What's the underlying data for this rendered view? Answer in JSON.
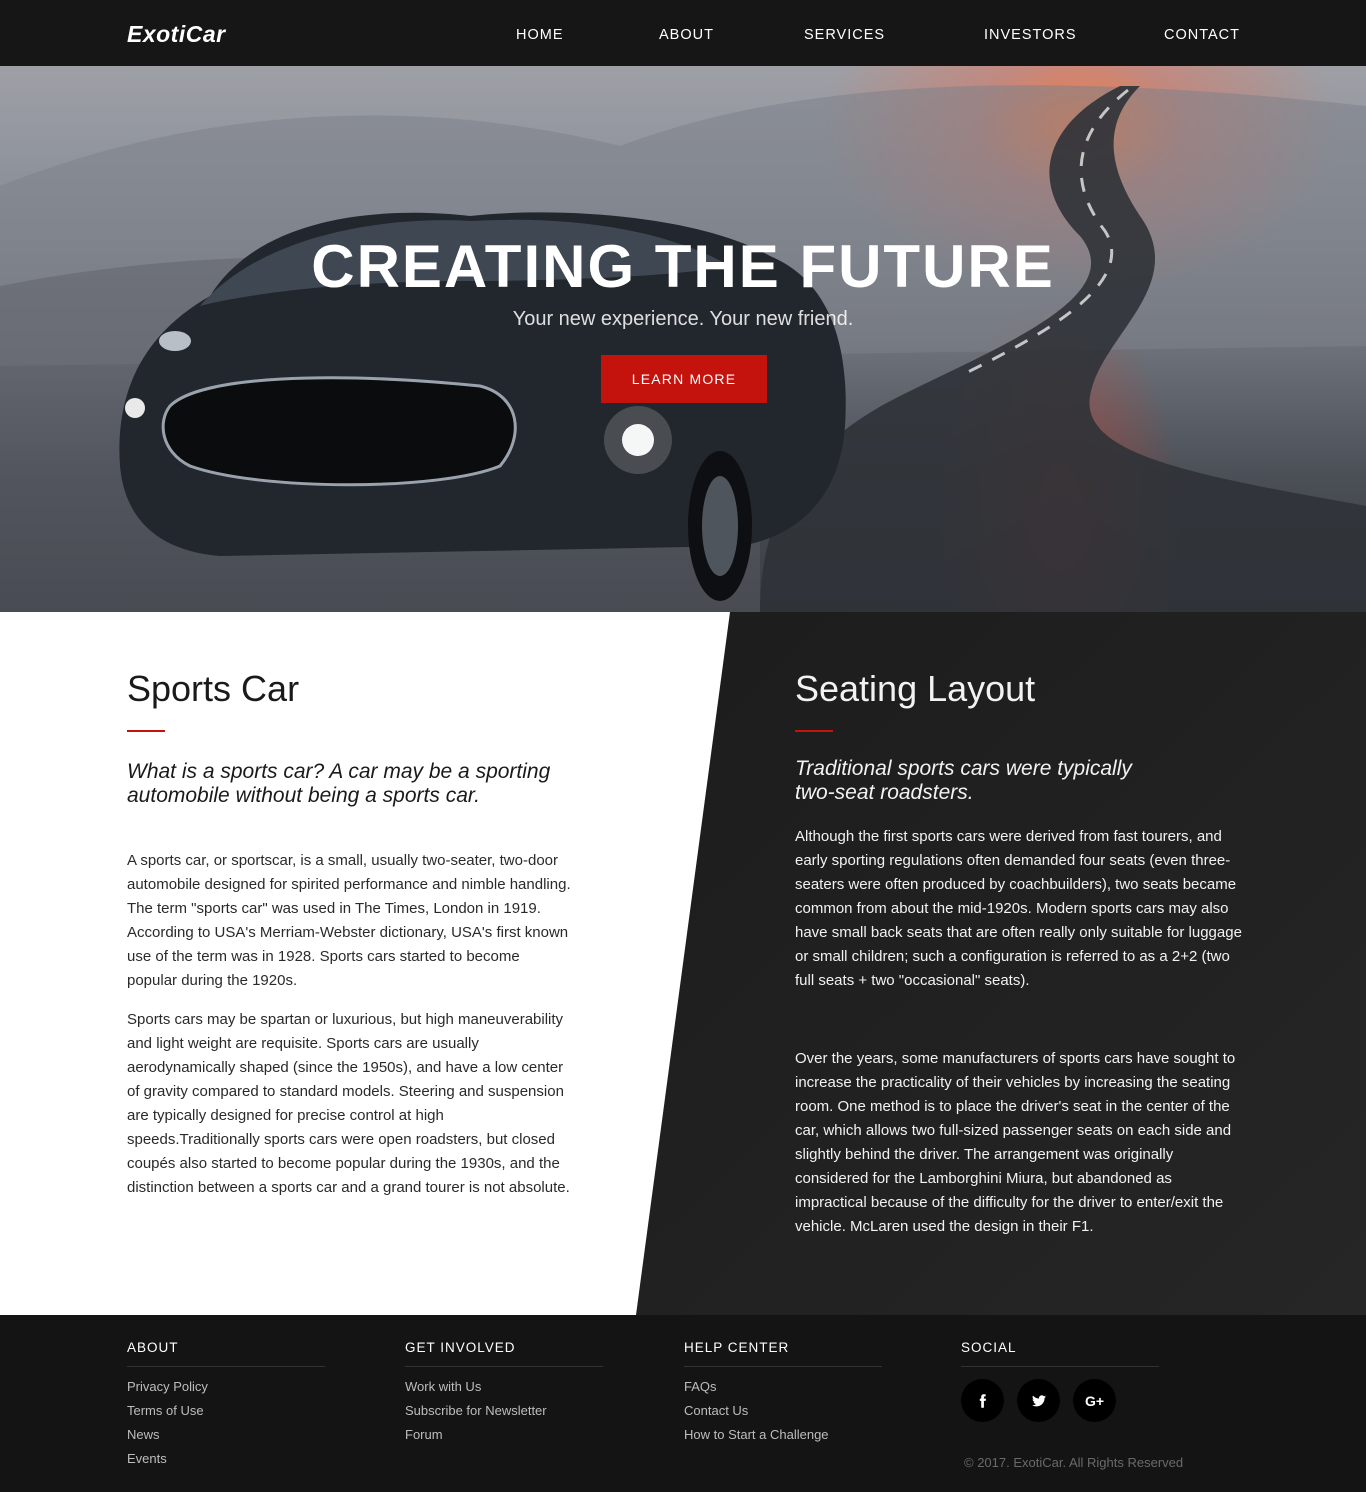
{
  "brand": {
    "logo_text": "ExotiCar"
  },
  "nav": {
    "items": [
      {
        "label": "HOME"
      },
      {
        "label": "ABOUT"
      },
      {
        "label": "SERVICES"
      },
      {
        "label": "INVESTORS"
      },
      {
        "label": "CONTACT"
      }
    ]
  },
  "hero": {
    "title": "CREATING THE FUTURE",
    "subtitle": "Your new experience. Your new friend.",
    "button_label": "LEARN MORE"
  },
  "left_col": {
    "title": "Sports Car",
    "lead": "What is a sports car? A car may be a sporting automobile without being a sports car.",
    "paragraphs": [
      "A sports car, or sportscar, is a small, usually two-seater, two-door automobile designed for spirited performance and nimble handling. The term \"sports car\" was used in The Times, London in 1919. According to USA's Merriam-Webster dictionary, USA's first known use of the term was in 1928. Sports cars started to become popular during the 1920s.",
      "Sports cars may be spartan or luxurious, but high maneuverability and light weight are requisite. Sports cars are usually aerodynamically shaped (since the 1950s), and have a low center of gravity compared to standard models. Steering and suspension are typically designed for precise control at high speeds.Traditionally sports cars were open roadsters, but closed coupés also started to become popular during the 1930s, and the distinction between a sports car and a grand tourer is not absolute."
    ]
  },
  "right_col": {
    "title": "Seating Layout",
    "lead": "Traditional sports cars were typically two-seat roadsters.",
    "paragraphs": [
      "Although the first sports cars were derived from fast tourers, and early sporting regulations often demanded four seats (even three-seaters were often produced by coachbuilders), two seats became common from about the mid-1920s. Modern sports cars may also have small back seats that are often really only suitable for luggage or small children; such a configuration is referred to as a 2+2 (two full seats + two \"occasional\" seats).",
      "Over the years, some manufacturers of sports cars have sought to increase the practicality of their vehicles by increasing the seating room. One method is to place the driver's seat in the center of the car, which allows two full-sized passenger seats on each side and slightly behind the driver. The arrangement was originally considered for the Lamborghini Miura, but abandoned as impractical because of the difficulty for the driver to enter/exit the vehicle. McLaren used the design in their F1."
    ]
  },
  "footer": {
    "about": {
      "heading": "ABOUT",
      "links": [
        "Privacy Policy",
        "Terms of Use",
        "News",
        "Events"
      ]
    },
    "get_involved": {
      "heading": "GET INVOLVED",
      "links": [
        "Work with Us",
        "Subscribe for Newsletter",
        "Forum"
      ]
    },
    "help_center": {
      "heading": "HELP CENTER",
      "links": [
        "FAQs",
        "Contact Us",
        "How to Start a Challenge"
      ]
    },
    "social": {
      "heading": "SOCIAL",
      "buttons": [
        {
          "icon": "facebook-icon",
          "glyph": "f"
        },
        {
          "icon": "twitter-icon",
          "glyph": "t"
        },
        {
          "icon": "google-plus-icon",
          "glyph": "G+"
        }
      ]
    },
    "copyright": "© 2017. ExotiCar. All Rights Reserved"
  },
  "colors": {
    "accent": "#c4120c",
    "dark": "#161616",
    "footer": "#141414",
    "panel_dark": "#1e1e1e"
  }
}
